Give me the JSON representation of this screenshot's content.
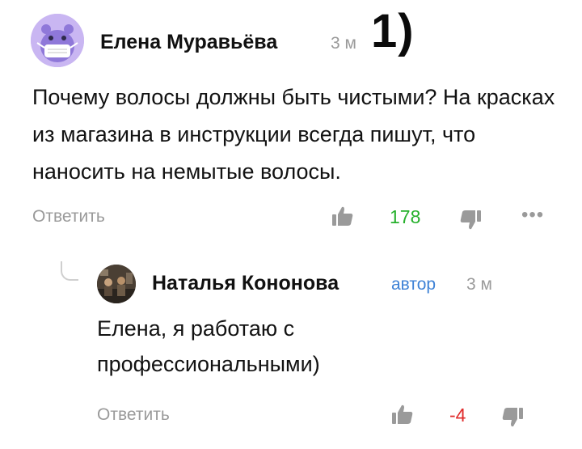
{
  "annotation": {
    "label": "1)"
  },
  "comments": [
    {
      "author": "Елена Муравьёва",
      "time": "3 м",
      "avatar": "hippo-with-mask-avatar",
      "text": "Почему волосы должны быть чистыми? На красках из магазина в инструкции всегда пишут, что наносить на немытые волосы.",
      "reply_label": "Ответить",
      "rating": "178",
      "rating_color": "#25b02b",
      "more": "•••"
    },
    {
      "author": "Наталья Кононова",
      "badge": "автор",
      "time": "3 м",
      "avatar": "photo-avatar",
      "text": "Елена, я работаю с профессиональными)",
      "reply_label": "Ответить",
      "rating": "-4",
      "rating_color": "#e02b2b"
    }
  ],
  "colors": {
    "muted": "#9a9a9a",
    "author_badge": "#3e82d6",
    "avatar1_bg": "#c9b6f2"
  }
}
